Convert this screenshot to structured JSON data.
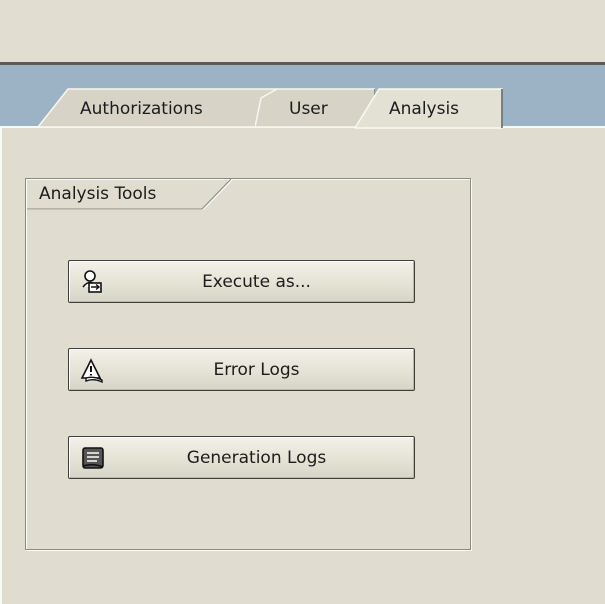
{
  "tabs": [
    {
      "label": "Authorizations",
      "active": false
    },
    {
      "label": "User",
      "active": false
    },
    {
      "label": "Analysis",
      "active": true
    }
  ],
  "group": {
    "title": "Analysis Tools"
  },
  "buttons": [
    {
      "label": "Execute as...",
      "icon": "user-execute-icon"
    },
    {
      "label": "Error Logs",
      "icon": "warning-log-icon"
    },
    {
      "label": "Generation Logs",
      "icon": "scroll-log-icon"
    }
  ],
  "colors": {
    "tab_strip": "#9bb3c4",
    "background": "#e0ddd0",
    "active_tab": "#e3e0d4",
    "inactive_tab": "#d6d3c6"
  }
}
